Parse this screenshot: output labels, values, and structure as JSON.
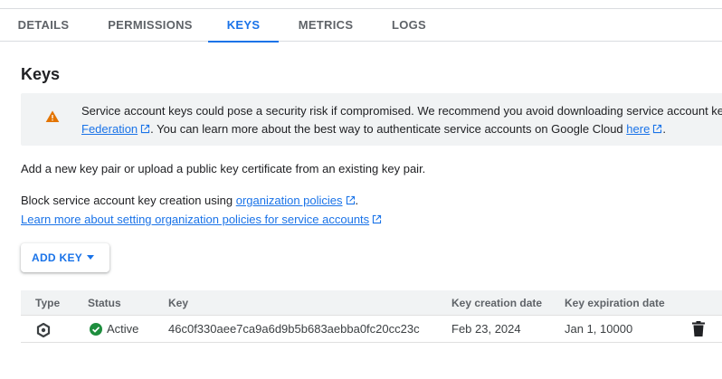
{
  "tabs": [
    {
      "label": "DETAILS",
      "active": false
    },
    {
      "label": "PERMISSIONS",
      "active": false
    },
    {
      "label": "KEYS",
      "active": true
    },
    {
      "label": "METRICS",
      "active": false
    },
    {
      "label": "LOGS",
      "active": false
    }
  ],
  "page": {
    "title": "Keys"
  },
  "warning": {
    "icon": "warning-icon",
    "text_1": "Service account keys could pose a security risk if compromised. We recommend you avoid downloading service account ke",
    "link_federation": "Federation",
    "text_2": ". You can learn more about the best way to authenticate service accounts on Google Cloud ",
    "link_here": "here",
    "text_3": "."
  },
  "info": {
    "add_text": "Add a new key pair or upload a public key certificate from an existing key pair.",
    "block_text": "Block service account key creation using ",
    "block_link": "organization policies",
    "block_end": ".",
    "learn_link": "Learn more about setting organization policies for service accounts"
  },
  "add_key_button": {
    "label": "ADD KEY"
  },
  "table": {
    "headers": [
      "Type",
      "Status",
      "Key",
      "Key creation date",
      "Key expiration date"
    ],
    "rows": [
      {
        "type_icon": "key-type-icon",
        "status": "Active",
        "key": "46c0f330aee7ca9a6d9b5b683aebba0fc20cc23c",
        "created": "Feb 23, 2024",
        "expires": "Jan 1, 10000",
        "action_icon": "trash-icon"
      }
    ]
  },
  "colors": {
    "accent": "#1a73e8",
    "warning": "#e37400",
    "success": "#1e8e3e",
    "panel_bg": "#f1f3f4"
  }
}
